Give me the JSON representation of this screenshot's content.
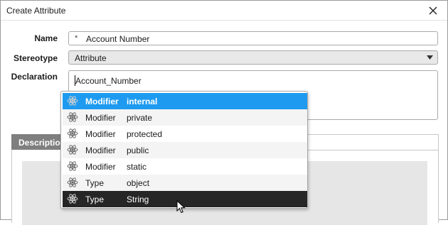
{
  "window": {
    "title": "Create Attribute"
  },
  "form": {
    "name_label": "Name",
    "name_value": "Account Number",
    "name_marker": "*",
    "stereotype_label": "Stereotype",
    "stereotype_value": "Attribute",
    "declaration_label": "Declaration",
    "declaration_value": "Account_Number"
  },
  "description": {
    "tab_label": "Descriptio"
  },
  "autocomplete": {
    "items": [
      {
        "kind": "Modifier",
        "value": "internal",
        "icon": "atom-icon",
        "state": "selected"
      },
      {
        "kind": "Modifier",
        "value": "private",
        "icon": "atom-icon",
        "state": "normal"
      },
      {
        "kind": "Modifier",
        "value": "protected",
        "icon": "atom-icon",
        "state": "normal"
      },
      {
        "kind": "Modifier",
        "value": "public",
        "icon": "atom-icon",
        "state": "normal"
      },
      {
        "kind": "Modifier",
        "value": "static",
        "icon": "atom-icon",
        "state": "normal"
      },
      {
        "kind": "Type",
        "value": "object",
        "icon": "atom-icon",
        "state": "normal"
      },
      {
        "kind": "Type",
        "value": "String",
        "icon": "atom-icon",
        "state": "hover"
      }
    ]
  },
  "colors": {
    "selected": "#1e9bf0",
    "hover": "#262626",
    "tab": "#7f7f7f"
  }
}
